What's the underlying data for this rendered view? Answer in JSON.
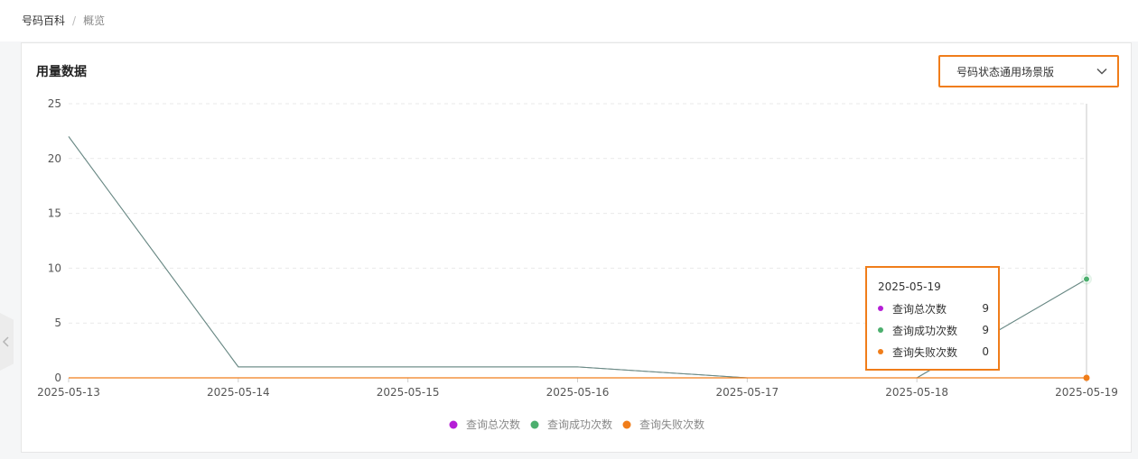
{
  "breadcrumb": {
    "root": "号码百科",
    "separator": "/",
    "current": "概览"
  },
  "card": {
    "title": "用量数据"
  },
  "select": {
    "value": "号码状态通用场景版"
  },
  "colors": {
    "total": "#b51ed6",
    "success": "#4caf6e",
    "fail": "#f07d1a",
    "line": "#6b8a86",
    "highlight": "#f07d1a"
  },
  "tooltip": {
    "date": "2025-05-19",
    "rows": [
      {
        "label": "查询总次数",
        "value": "9",
        "color": "#b51ed6"
      },
      {
        "label": "查询成功次数",
        "value": "9",
        "color": "#4caf6e"
      },
      {
        "label": "查询失败次数",
        "value": "0",
        "color": "#f07d1a"
      }
    ]
  },
  "chart_data": {
    "type": "line",
    "title": "用量数据",
    "categories": [
      "2025-05-13",
      "2025-05-14",
      "2025-05-15",
      "2025-05-16",
      "2025-05-17",
      "2025-05-18",
      "2025-05-19"
    ],
    "ylim": [
      0,
      25
    ],
    "yticks": [
      0,
      5,
      10,
      15,
      20,
      25
    ],
    "grid": true,
    "legend_position": "bottom",
    "series": [
      {
        "name": "查询总次数",
        "values": [
          22,
          1,
          1,
          1,
          0,
          0,
          9
        ]
      },
      {
        "name": "查询成功次数",
        "values": [
          22,
          1,
          1,
          1,
          0,
          0,
          9
        ]
      },
      {
        "name": "查询失败次数",
        "values": [
          0,
          0,
          0,
          0,
          0,
          0,
          0
        ]
      }
    ]
  },
  "icons": {
    "select_arrow": "chevron-down-icon",
    "collapse": "chevron-left-icon"
  }
}
